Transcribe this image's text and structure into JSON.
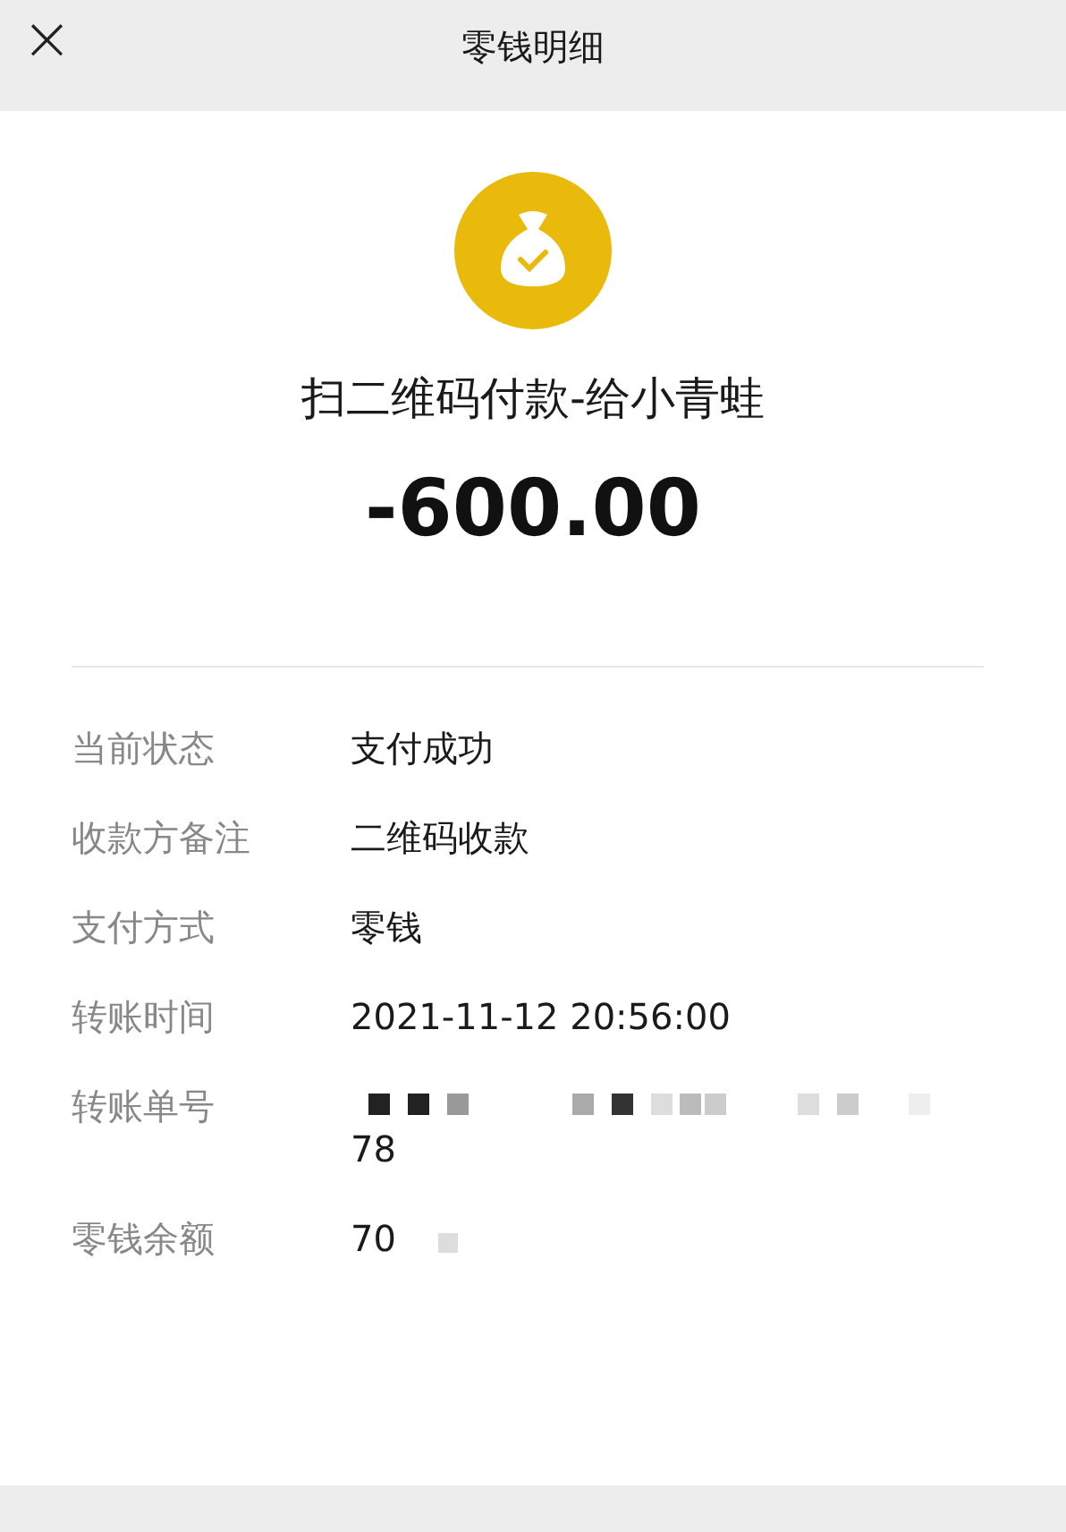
{
  "header": {
    "close": "×",
    "title": "零钱明细"
  },
  "summary": {
    "title": "扫二维码付款-给小青蛙",
    "amount": "-600.00"
  },
  "details": [
    {
      "label": "当前状态",
      "value": "支付成功",
      "redacted": false
    },
    {
      "label": "收款方备注",
      "value": "二维码收款",
      "redacted": false
    },
    {
      "label": "支付方式",
      "value": "零钱",
      "redacted": false
    },
    {
      "label": "转账时间",
      "value": "2021-11-12 20:56:00",
      "redacted": false
    },
    {
      "label": "转账单号",
      "value": "78",
      "redacted": true
    },
    {
      "label": "零钱余额",
      "value": "70",
      "redacted": true
    }
  ]
}
